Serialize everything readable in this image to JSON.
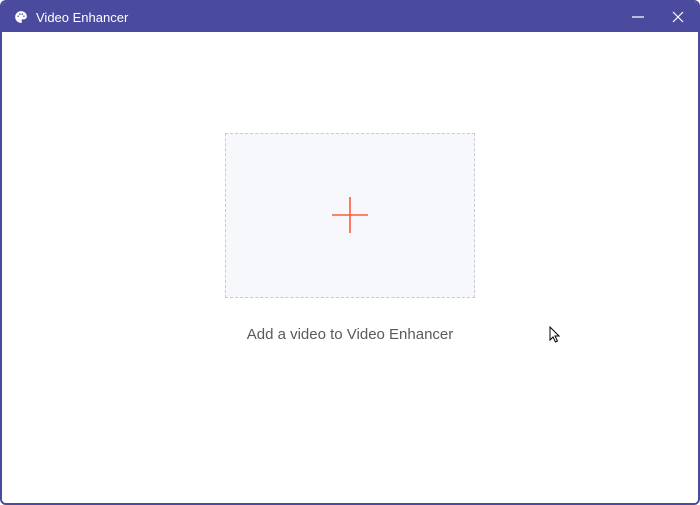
{
  "titlebar": {
    "app_title": "Video Enhancer"
  },
  "main": {
    "instruction": "Add a video to Video Enhancer"
  },
  "colors": {
    "accent": "#4a4a9e",
    "plus": "#ff5a3c"
  }
}
